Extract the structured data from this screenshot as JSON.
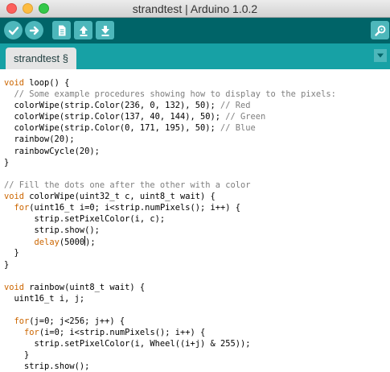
{
  "window": {
    "title": "strandtest | Arduino 1.0.2"
  },
  "toolbar": {
    "buttons": [
      {
        "name": "verify",
        "icon": "checkmark-icon"
      },
      {
        "name": "upload",
        "icon": "arrow-right-icon"
      },
      {
        "name": "new",
        "icon": "document-icon"
      },
      {
        "name": "open",
        "icon": "arrow-up-icon"
      },
      {
        "name": "save",
        "icon": "arrow-down-icon"
      },
      {
        "name": "serial-monitor",
        "icon": "magnifier-icon"
      }
    ]
  },
  "tabs": [
    {
      "label": "strandtest §"
    }
  ],
  "colors": {
    "toolbar": "#006468",
    "tabbar": "#17a1a5",
    "button": "#4db7bb",
    "keyword": "#cc6600",
    "comment": "#7e7e7e"
  },
  "editor": {
    "lines": [
      [
        {
          "t": "void",
          "c": "kw"
        },
        {
          "t": " loop() {"
        }
      ],
      [
        {
          "t": "  // Some example procedures showing how to display to the pixels:",
          "c": "cm"
        }
      ],
      [
        {
          "t": "  colorWipe(strip.Color(236, 0, 132), 50); "
        },
        {
          "t": "// Red",
          "c": "cm"
        }
      ],
      [
        {
          "t": "  colorWipe(strip.Color(137, 40, 144), 50); "
        },
        {
          "t": "// Green",
          "c": "cm"
        }
      ],
      [
        {
          "t": "  colorWipe(strip.Color(0, 171, 195), 50); "
        },
        {
          "t": "// Blue",
          "c": "cm"
        }
      ],
      [
        {
          "t": "  rainbow(20);"
        }
      ],
      [
        {
          "t": "  rainbowCycle(20);"
        }
      ],
      [
        {
          "t": "}"
        }
      ],
      [
        {
          "t": ""
        }
      ],
      [
        {
          "t": "// Fill the dots one after the other with a color",
          "c": "cm"
        }
      ],
      [
        {
          "t": "void",
          "c": "kw"
        },
        {
          "t": " colorWipe(uint32_t c, uint8_t wait) {"
        }
      ],
      [
        {
          "t": "  "
        },
        {
          "t": "for",
          "c": "kw"
        },
        {
          "t": "(uint16_t i=0; i<strip.numPixels(); i++) {"
        }
      ],
      [
        {
          "t": "      strip.setPixelColor(i, c);"
        }
      ],
      [
        {
          "t": "      strip.show();"
        }
      ],
      [
        {
          "t": "      "
        },
        {
          "t": "delay",
          "c": "kw"
        },
        {
          "t": "(5000"
        },
        {
          "caret": true
        },
        {
          "t": ");"
        }
      ],
      [
        {
          "t": "  }"
        }
      ],
      [
        {
          "t": "}"
        }
      ],
      [
        {
          "t": ""
        }
      ],
      [
        {
          "t": "void",
          "c": "kw"
        },
        {
          "t": " rainbow(uint8_t wait) {"
        }
      ],
      [
        {
          "t": "  uint16_t i, j;"
        }
      ],
      [
        {
          "t": ""
        }
      ],
      [
        {
          "t": "  "
        },
        {
          "t": "for",
          "c": "kw"
        },
        {
          "t": "(j=0; j<256; j++) {"
        }
      ],
      [
        {
          "t": "    "
        },
        {
          "t": "for",
          "c": "kw"
        },
        {
          "t": "(i=0; i<strip.numPixels(); i++) {"
        }
      ],
      [
        {
          "t": "      strip.setPixelColor(i, Wheel((i+j) & 255));"
        }
      ],
      [
        {
          "t": "    }"
        }
      ],
      [
        {
          "t": "    strip.show();"
        }
      ]
    ]
  }
}
